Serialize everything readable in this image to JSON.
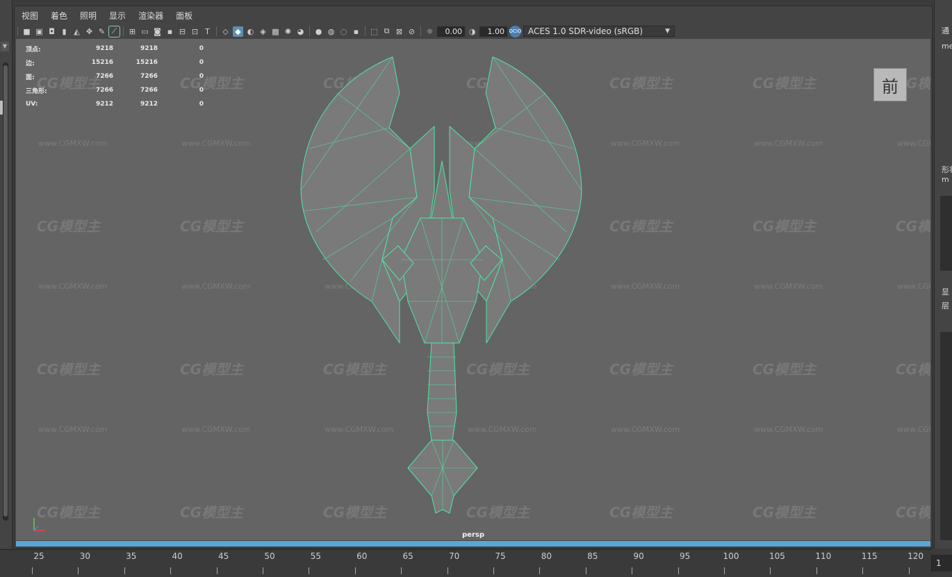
{
  "menu": [
    "视图",
    "着色",
    "照明",
    "显示",
    "渲染器",
    "面板"
  ],
  "toolbar": {
    "exposure": "0.00",
    "gamma": "1.00",
    "color_space": "ACES 1.0 SDR-video (sRGB)"
  },
  "hud": [
    {
      "label": "顶点:",
      "v1": "9218",
      "v2": "9218",
      "v3": "0"
    },
    {
      "label": "边:",
      "v1": "15216",
      "v2": "15216",
      "v3": "0"
    },
    {
      "label": "面:",
      "v1": "7266",
      "v2": "7266",
      "v3": "0"
    },
    {
      "label": "三角形:",
      "v1": "7266",
      "v2": "7266",
      "v3": "0"
    },
    {
      "label": "UV:",
      "v1": "9212",
      "v2": "9212",
      "v3": "0"
    }
  ],
  "viewcube_label": "前",
  "camera_label": "persp",
  "watermark": {
    "logo": "CG模型主",
    "url": "www.CGMXW.com"
  },
  "right_panel": {
    "t1": "通",
    "t2": "me",
    "t3": "形状",
    "t4": "m",
    "t5": "显",
    "t6": "层"
  },
  "timeline": {
    "ticks": [
      "25",
      "30",
      "35",
      "40",
      "45",
      "50",
      "55",
      "60",
      "65",
      "70",
      "75",
      "80",
      "85",
      "90",
      "95",
      "100",
      "105",
      "110",
      "115",
      "120"
    ],
    "current_frame": "1"
  },
  "colors": {
    "wireframe": "#4fe6a6",
    "viewport_bg": "#646464",
    "timeline_bar": "#5aa6d6"
  }
}
